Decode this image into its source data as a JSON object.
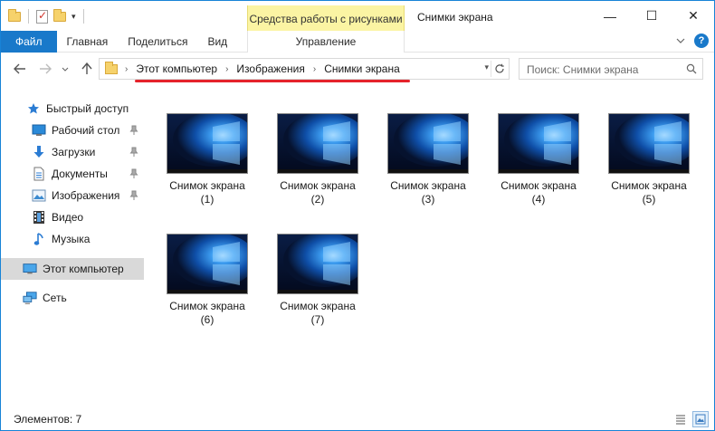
{
  "titlebar": {
    "contextual_tab": "Средства работы с рисунками",
    "title": "Снимки экрана",
    "minimize": "—",
    "maximize": "☐",
    "close": "✕"
  },
  "ribbon": {
    "tabs": {
      "file": "Файл",
      "home": "Главная",
      "share": "Поделиться",
      "view": "Вид",
      "manage": "Управление"
    },
    "help": "?"
  },
  "address": {
    "breadcrumbs": [
      "Этот компьютер",
      "Изображения",
      "Снимки экрана"
    ],
    "search_placeholder": "Поиск: Снимки экрана"
  },
  "navigation": {
    "quick_access": "Быстрый доступ",
    "items": [
      {
        "label": "Рабочий стол",
        "icon": "desktop-icon",
        "pinned": true
      },
      {
        "label": "Загрузки",
        "icon": "downloads-icon",
        "pinned": true
      },
      {
        "label": "Документы",
        "icon": "documents-icon",
        "pinned": true
      },
      {
        "label": "Изображения",
        "icon": "pictures-icon",
        "pinned": true
      },
      {
        "label": "Видео",
        "icon": "video-icon",
        "pinned": false
      },
      {
        "label": "Музыка",
        "icon": "music-icon",
        "pinned": false
      }
    ],
    "this_pc": "Этот компьютер",
    "network": "Сеть"
  },
  "files": [
    {
      "name": "Снимок экрана",
      "index": "(1)"
    },
    {
      "name": "Снимок экрана",
      "index": "(2)"
    },
    {
      "name": "Снимок экрана",
      "index": "(3)"
    },
    {
      "name": "Снимок экрана",
      "index": "(4)"
    },
    {
      "name": "Снимок экрана",
      "index": "(5)"
    },
    {
      "name": "Снимок экрана",
      "index": "(6)"
    },
    {
      "name": "Снимок экрана",
      "index": "(7)"
    }
  ],
  "status": {
    "items_count": "Элементов: 7"
  },
  "colors": {
    "accent": "#1979ca",
    "contextual": "#fbf4a3",
    "annotation": "#e5232b"
  }
}
